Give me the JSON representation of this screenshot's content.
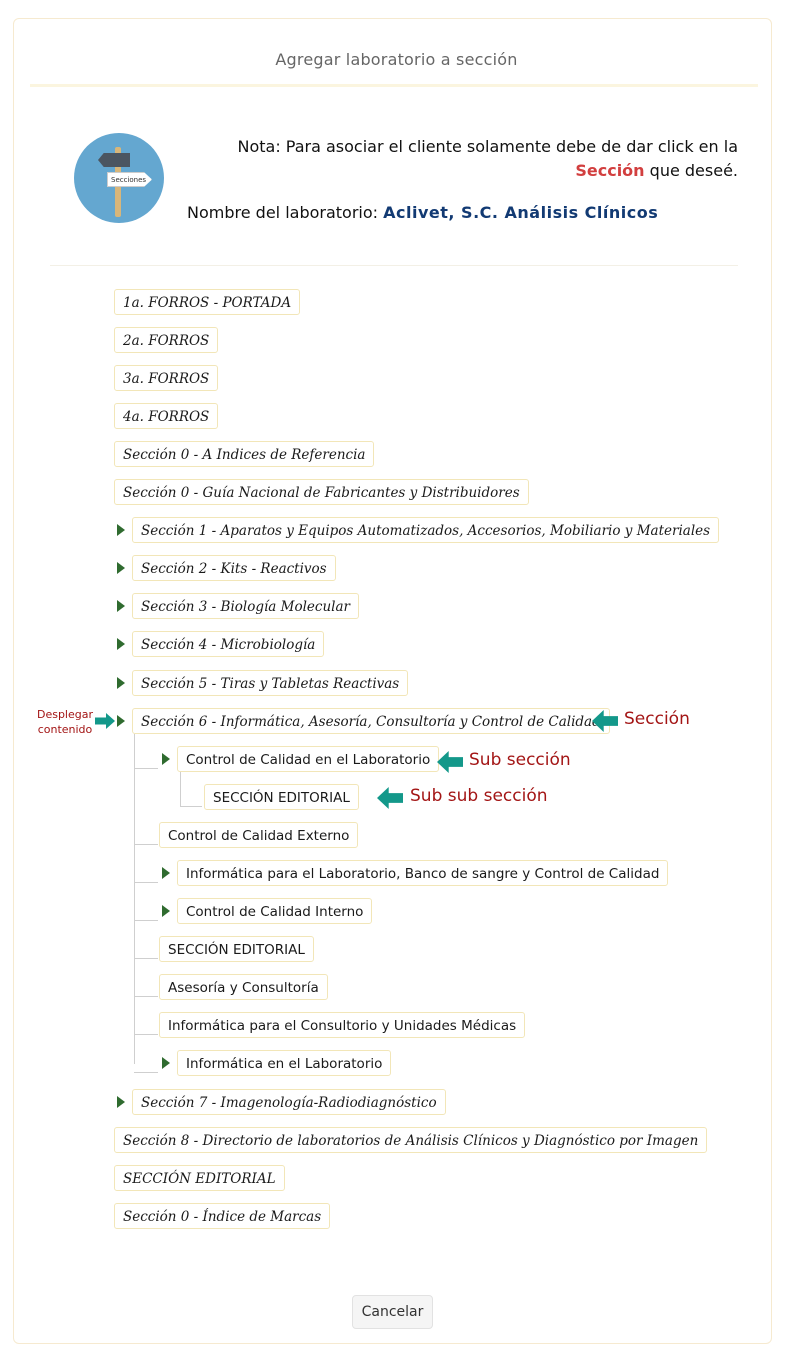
{
  "dialog": {
    "title": "Agregar laboratorio a sección",
    "logo_text": "Secciones",
    "note_prefix": "Nota: Para asociar el cliente solamente debe de dar click en la",
    "note_highlight": "Sección",
    "note_suffix": "que deseé.",
    "lab_label": "Nombre del laboratorio:",
    "lab_name": "Aclivet, S.C. Análisis Clínicos",
    "cancel_label": "Cancelar"
  },
  "annotations": {
    "expand_line1": "Desplegar",
    "expand_line2": "contenido",
    "section": "Sección",
    "sub_section": "Sub sección",
    "sub_sub_section": "Sub sub sección"
  },
  "tree": {
    "n1": "1a. FORROS - PORTADA",
    "n2": "2a. FORROS",
    "n3": "3a. FORROS",
    "n4": "4a. FORROS",
    "n5": "Sección 0 - A Indices de Referencia",
    "n6": "Sección 0 - Guía Nacional de Fabricantes y Distribuidores",
    "n7": "Sección 1 - Aparatos y Equipos Automatizados, Accesorios, Mobiliario y Materiales",
    "n8": "Sección 2 - Kits - Reactivos",
    "n9": "Sección 3 - Biología Molecular",
    "n10": "Sección 4 - Microbiología",
    "n11": "Sección 5 - Tiras y Tabletas Reactivas",
    "n12": "Sección 6 - Informática, Asesoría, Consultoría y Control de Calidad",
    "c1": "Control de Calidad en el Laboratorio",
    "c1a": "SECCIÓN EDITORIAL",
    "c2": "Control de Calidad Externo",
    "c3": "Informática para el Laboratorio, Banco de sangre y Control de Calidad",
    "c4": "Control de Calidad Interno",
    "c5": "SECCIÓN EDITORIAL",
    "c6": "Asesoría y Consultoría",
    "c7": "Informática para el Consultorio y Unidades Médicas",
    "c8": "Informática en el Laboratorio",
    "n13": "Sección 7 - Imagenología-Radiodiagnóstico",
    "n14": "Sección 8 - Directorio de laboratorios de Análisis Clínicos y Diagnóstico por Imagen",
    "n15": "SECCIÓN EDITORIAL",
    "n16": "Sección 0 - Índice de Marcas"
  }
}
